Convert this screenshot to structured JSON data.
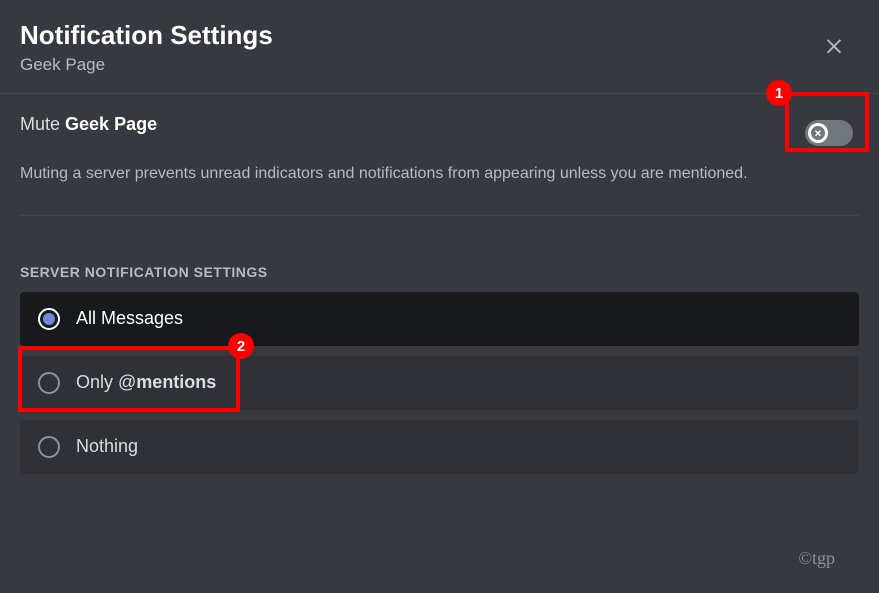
{
  "header": {
    "title": "Notification Settings",
    "subtitle": "Geek Page"
  },
  "mute": {
    "prefix": "Mute ",
    "target": "Geek Page",
    "description": "Muting a server prevents unread indicators and notifications from appearing unless you are mentioned.",
    "enabled": false
  },
  "section": {
    "heading": "SERVER NOTIFICATION SETTINGS"
  },
  "options": {
    "all": {
      "label": "All Messages",
      "selected": true
    },
    "mentions": {
      "prefix": "Only ",
      "at": "@",
      "suffix": "mentions",
      "selected": false
    },
    "nothing": {
      "label": "Nothing",
      "selected": false
    }
  },
  "annotations": {
    "badge1": "1",
    "badge2": "2"
  },
  "watermark": "©tgp"
}
